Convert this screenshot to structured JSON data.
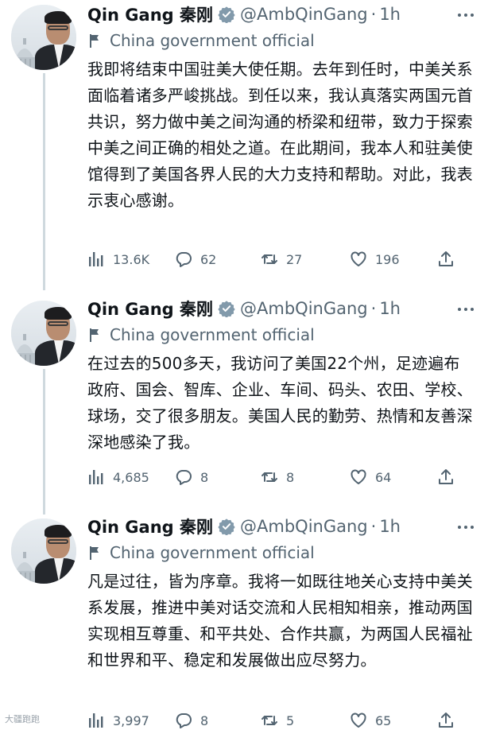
{
  "tweets": [
    {
      "name": "Qin Gang 秦刚",
      "handle": "@AmbQinGang",
      "separator": "·",
      "time": "1h",
      "label": "China government official",
      "text": "我即将结束中国驻美大使任期。去年到任时，中美关系面临着诸多严峻挑战。到任以来，我认真落实两国元首共识，努力做中美之间沟通的桥梁和纽带，致力于探索中美之间正确的相处之道。在此期间，我本人和驻美使馆得到了美国各界人民的大力支持和帮助。对此，我表示衷心感谢。",
      "views": "13.6K",
      "replies": "62",
      "retweets": "27",
      "likes": "196"
    },
    {
      "name": "Qin Gang 秦刚",
      "handle": "@AmbQinGang",
      "separator": "·",
      "time": "1h",
      "label": "China government official",
      "text": "在过去的500多天，我访问了美国22个州，足迹遍布政府、国会、智库、企业、车间、码头、农田、学校、球场，交了很多朋友。美国人民的勤劳、热情和友善深深地感染了我。",
      "views": "4,685",
      "replies": "8",
      "retweets": "8",
      "likes": "64"
    },
    {
      "name": "Qin Gang 秦刚",
      "handle": "@AmbQinGang",
      "separator": "·",
      "time": "1h",
      "label": "China government official",
      "text": "凡是过往，皆为序章。我将一如既往地关心支持中美关系发展，推进中美对话交流和人民相知相亲，推动两国实现相互尊重、和平共处、合作共赢，为两国人民福祉和世界和平、稳定和发展做出应尽努力。",
      "views": "3,997",
      "replies": "8",
      "retweets": "5",
      "likes": "65"
    }
  ],
  "watermark": "大疆跑跑",
  "colors": {
    "verified": "#829aab",
    "text": "#0f1419",
    "muted": "#536471",
    "thread_line": "#cfd9de"
  },
  "icons": {
    "views": "bar-chart-icon",
    "replies": "speech-bubble-icon",
    "retweets": "retweet-arrows-icon",
    "likes": "heart-icon",
    "share": "share-upload-icon",
    "label": "flag-icon",
    "badge": "verified-badge-icon",
    "more": "more-dots-icon"
  }
}
